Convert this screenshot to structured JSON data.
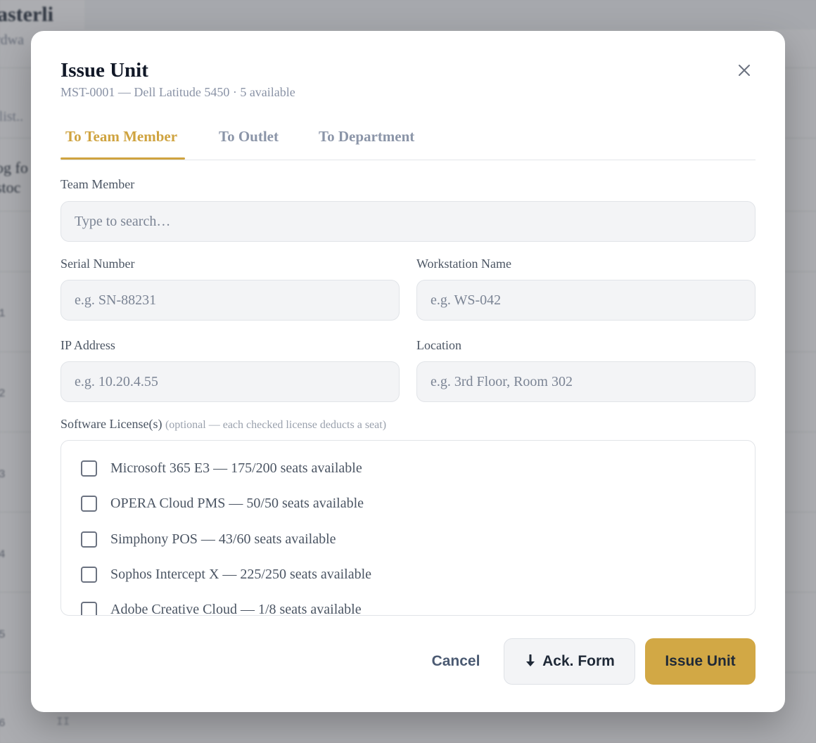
{
  "backdrop": {
    "brand": "asterli",
    "brand_sub": "rdwa",
    "search_fragment": "rlist..",
    "intro_line1": "og fo",
    "intro_line2": "stoc",
    "row_numbers": [
      "1",
      "2",
      "3",
      "4",
      "5",
      "6"
    ],
    "last_row_text": "II"
  },
  "modal": {
    "title": "Issue Unit",
    "subtitle": "MST-0001 — Dell Latitude 5450 · 5 available",
    "close_icon": "close-icon",
    "tabs": [
      {
        "label": "To Team Member",
        "active": true
      },
      {
        "label": "To Outlet",
        "active": false
      },
      {
        "label": "To Department",
        "active": false
      }
    ],
    "team_member": {
      "label": "Team Member",
      "placeholder": "Type to search…",
      "value": ""
    },
    "serial_number": {
      "label": "Serial Number",
      "placeholder": "e.g. SN-88231",
      "value": ""
    },
    "workstation_name": {
      "label": "Workstation Name",
      "placeholder": "e.g. WS-042",
      "value": ""
    },
    "ip_address": {
      "label": "IP Address",
      "placeholder": "e.g. 10.20.4.55",
      "value": ""
    },
    "location": {
      "label": "Location",
      "placeholder": "e.g. 3rd Floor, Room 302",
      "value": ""
    },
    "licenses": {
      "label": "Software License(s)",
      "hint": "(optional — each checked license deducts a seat)",
      "items": [
        {
          "label": "Microsoft 365 E3 — 175/200 seats available",
          "checked": false
        },
        {
          "label": "OPERA Cloud PMS — 50/50 seats available",
          "checked": false
        },
        {
          "label": "Simphony POS — 43/60 seats available",
          "checked": false
        },
        {
          "label": "Sophos Intercept X — 225/250 seats available",
          "checked": false
        },
        {
          "label": "Adobe Creative Cloud — 1/8 seats available",
          "checked": false
        }
      ]
    },
    "actions": {
      "cancel": "Cancel",
      "ack_form": "Ack. Form",
      "ack_icon": "download-arrow-icon",
      "issue": "Issue Unit"
    }
  },
  "colors": {
    "accent": "#cfa33f",
    "primary_button": "#d2a845",
    "tab_inactive": "#8b95a8"
  }
}
